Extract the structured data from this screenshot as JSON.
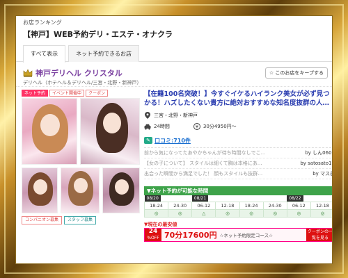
{
  "breadcrumb": "お店ランキング",
  "page_title": "【神戸】WEB予約デリ・エステ・オナクラ",
  "tabs": [
    {
      "label": "すべて表示"
    },
    {
      "label": "ネット予約できるお店"
    }
  ],
  "shop": {
    "name": "神戸デリヘル クリスタル",
    "keep_button": "このお店をキープする",
    "subtitle": "デリヘル（ホテヘル＆デリヘル/三宮・北野・新神戸）",
    "badges": [
      "ネット予約",
      "イベント開催中",
      "クーポン"
    ],
    "footer_badges": [
      "コンパニオン募集",
      "スタッフ募集"
    ],
    "catch": "【在籍100名突破！】今すぐイケるハイランク美女が必ず見つかる！ハズしたくない貴方に絶対おすすめな知名度抜群の人…",
    "area": "三宮・北野・新神戸",
    "hours": "24時間",
    "price": "30分4950円～",
    "review_link": "口コミ:710件",
    "reviews": [
      {
        "text": "前から気になってたあやかちゃんが待ち時間なしでこ…",
        "author": "by しん0601"
      },
      {
        "text": "【女の子について】 スタイルは細くて胸は本格にあ…",
        "author": "by satosato19"
      },
      {
        "text": "出会った瞬間から満足でした！ 顔もスタイルも抜群…",
        "author": "by マス谷"
      }
    ]
  },
  "schedule": {
    "heading": "▼ネット予約が可能な時間",
    "dates": [
      "08/20",
      "08/21",
      "08/22"
    ],
    "slots": [
      "18-24",
      "24-30",
      "06-12",
      "12-18",
      "18-24",
      "24-30",
      "06-12",
      "12-18"
    ],
    "marks": [
      "◎",
      "◎",
      "△",
      "◎",
      "◎",
      "◎",
      "◎",
      "◎"
    ]
  },
  "coupon": {
    "heading": "▼現在の最安値",
    "pct_top": "24",
    "pct_unit": "%OFF",
    "price": "70分17600円",
    "course": "☆ネット予約限定コース☆",
    "button": "クーポンの一覧を見る"
  },
  "colors": {
    "accent": "#2a3db0",
    "shop_name": "#7a3fa0",
    "schedule": "#3ea34a",
    "coupon": "#d11111"
  }
}
